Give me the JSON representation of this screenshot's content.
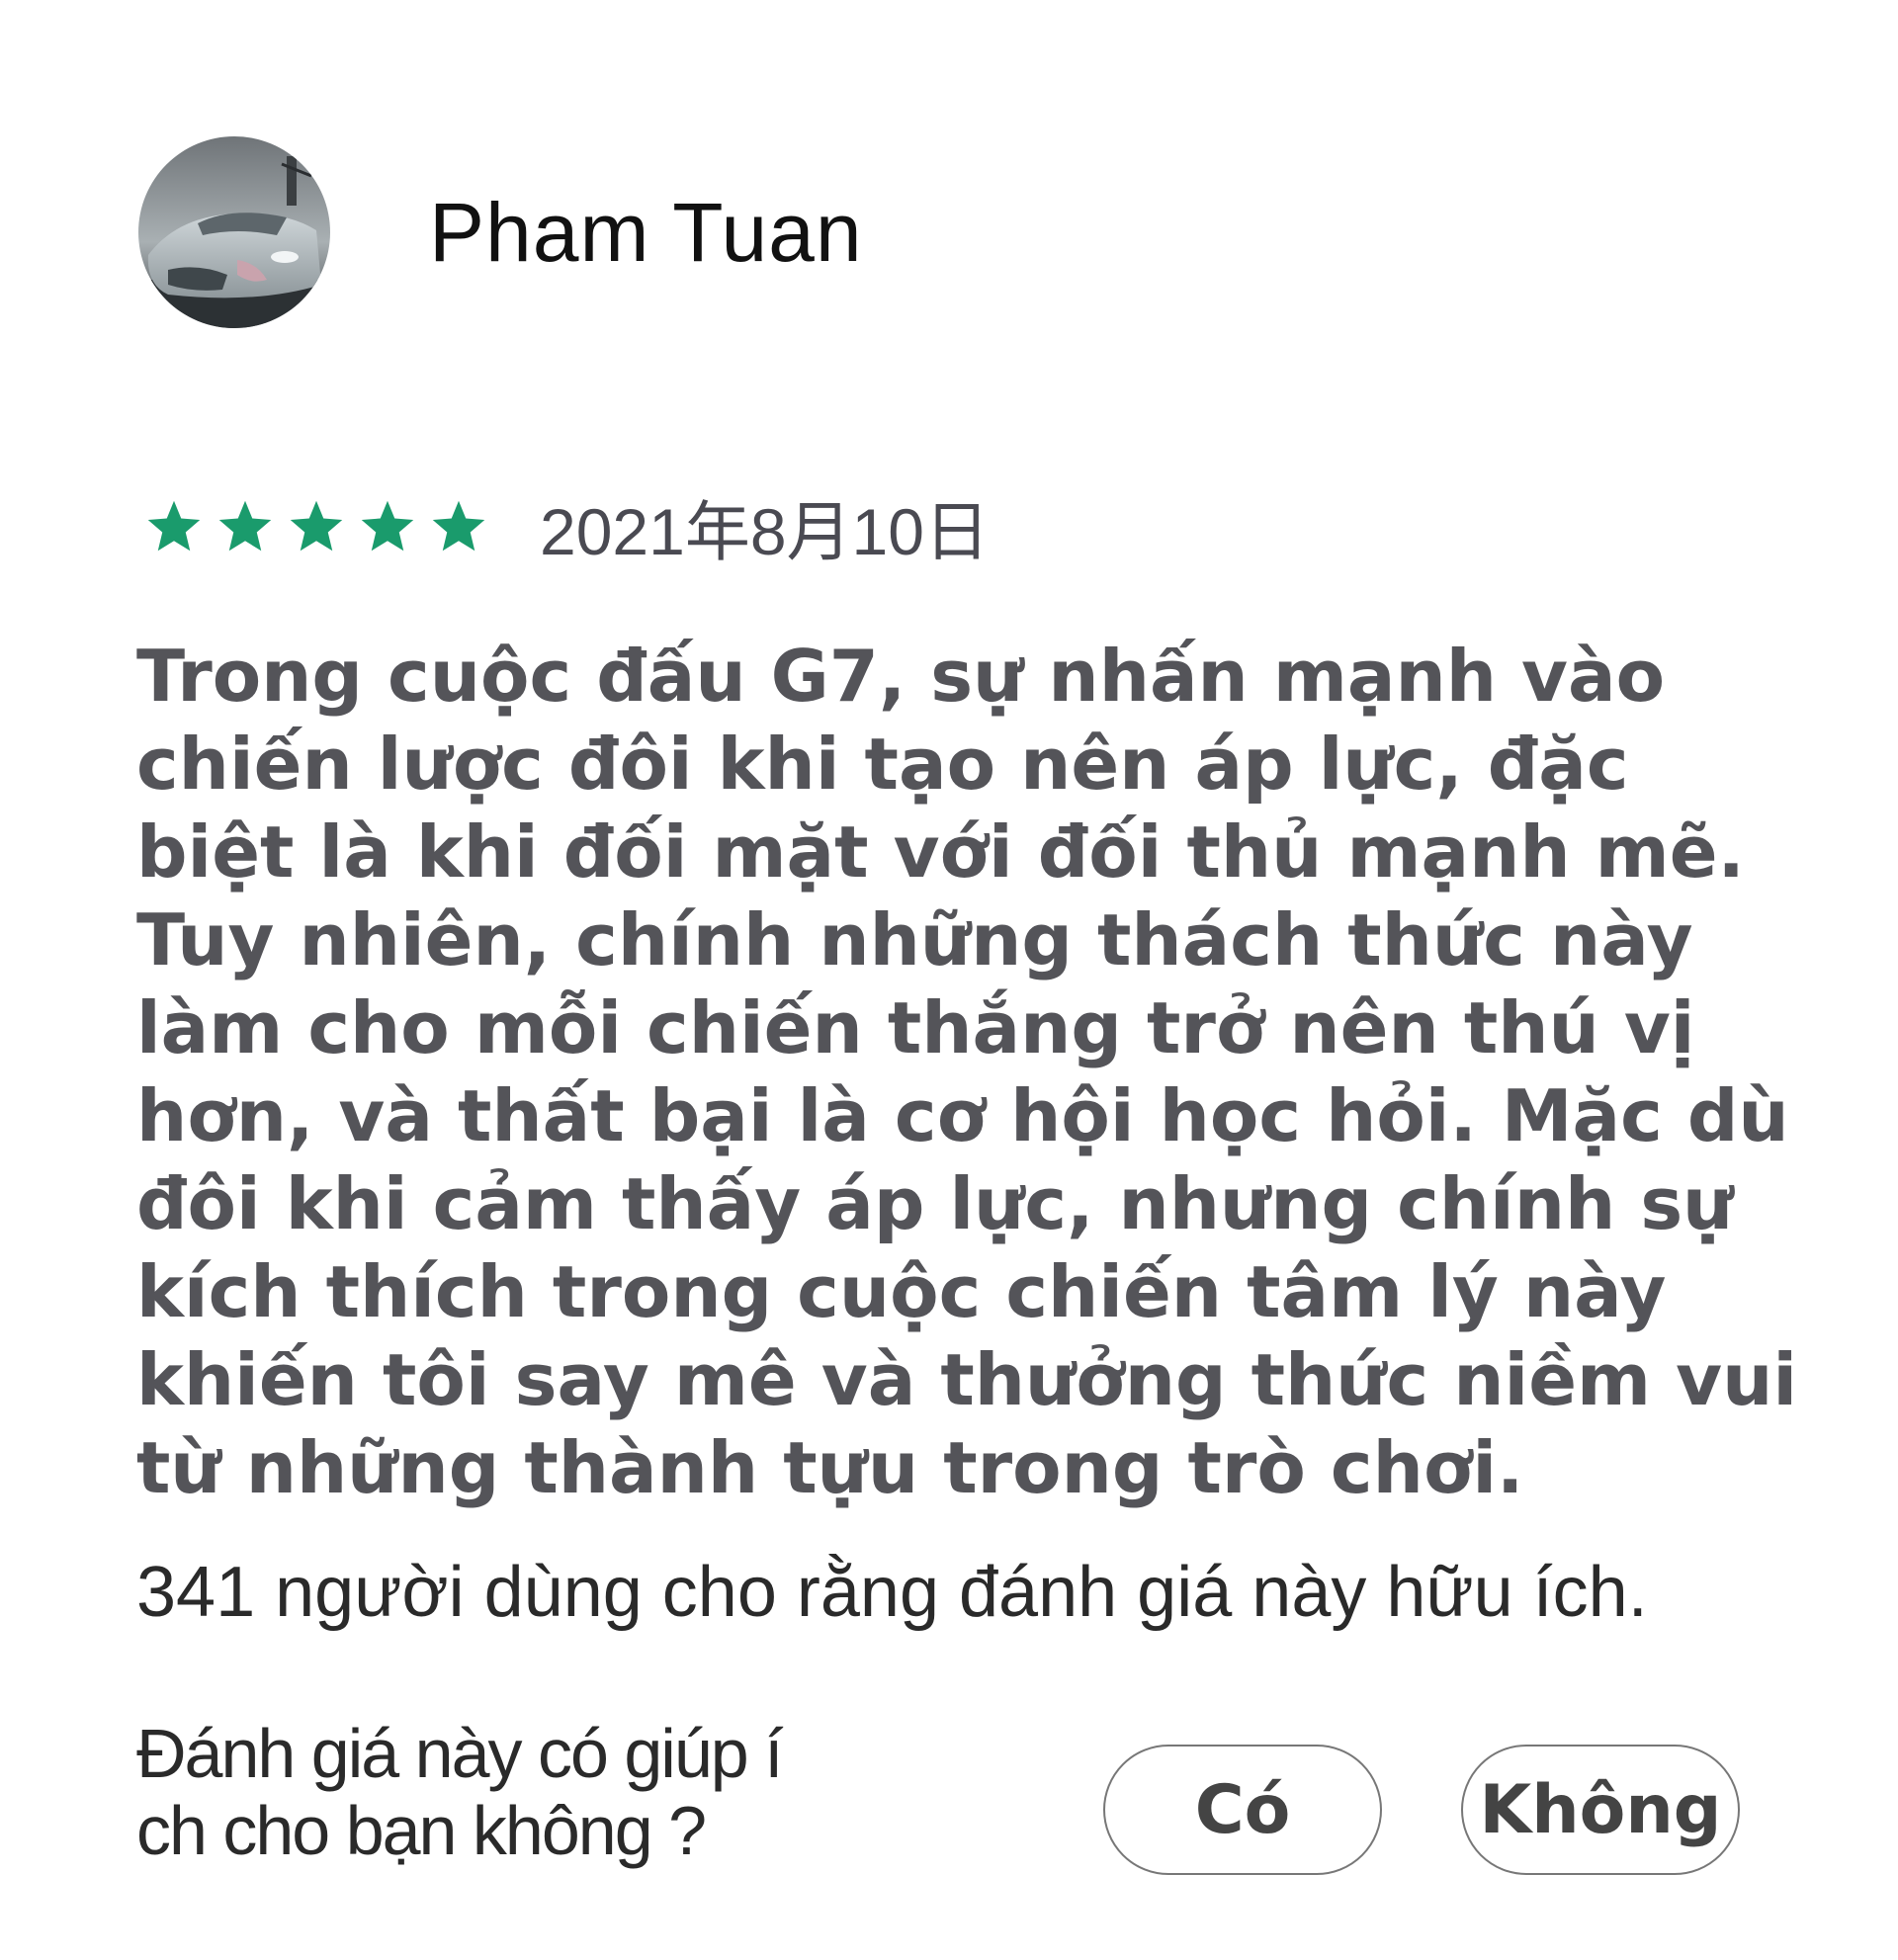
{
  "review": {
    "reviewer_name": "Pham Tuan",
    "avatar_icon": "car-photo-avatar",
    "rating": 5,
    "rating_max": 5,
    "star_color": "#1a9b6c",
    "date": "2021年8月10日",
    "body": "Trong cuộc đấu G7, sự nhấn mạnh vào chiến lược đôi khi tạo nên áp lực, đặc biệt là khi đối mặt với đối thủ mạnh mẽ. Tuy nhiên, chính những thách thức này làm cho mỗi chiến thắng trở nên thú vị hơn, và thất bại là cơ hội học hỏi. Mặc dù đôi khi cảm thấy áp lực, nhưng chính sự kích thích trong cuộc chiến tâm lý này khiến tôi say mê và thưởng thức niềm vui từ những thành tựu trong trò chơi.",
    "helpful_count_text": "341 người dùng cho rằng đánh giá này hữu ích."
  },
  "feedback": {
    "question": "Đánh giá này có giúp í ch cho bạn không ?",
    "yes_label": "Có",
    "no_label": "Không"
  }
}
